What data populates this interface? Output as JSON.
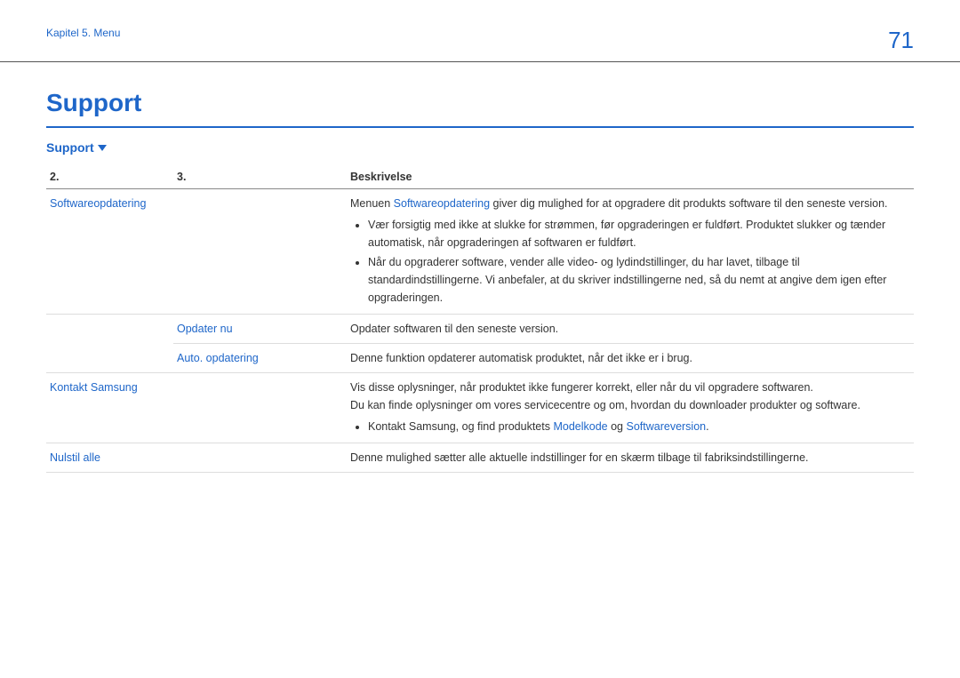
{
  "header": {
    "chapter": "Kapitel 5. Menu",
    "page_number": "71"
  },
  "title": "Support",
  "subtitle": "Support",
  "table": {
    "headers": {
      "col1": "2.",
      "col2": "3.",
      "col3": "Beskrivelse"
    },
    "rows": {
      "r1": {
        "col1": "Softwareopdatering",
        "desc_prefix": "Menuen ",
        "desc_menu": "Softwareopdatering",
        "desc_suffix": " giver dig mulighed for at opgradere dit produkts software til den seneste version.",
        "bullet1": "Vær forsigtig med ikke at slukke for strømmen, før opgraderingen er fuldført. Produktet slukker og tænder automatisk, når opgraderingen af softwaren er fuldført.",
        "bullet2": "Når du opgraderer software, vender alle video- og lydindstillinger, du har lavet, tilbage til standardindstillingerne. Vi anbefaler, at du skriver indstillingerne ned, så du nemt at angive dem igen efter opgraderingen."
      },
      "r2": {
        "col2": "Opdater nu",
        "desc": "Opdater softwaren til den seneste version."
      },
      "r3": {
        "col2": "Auto. opdatering",
        "desc": "Denne funktion opdaterer automatisk produktet, når det ikke er i brug."
      },
      "r4": {
        "col1": "Kontakt Samsung",
        "desc_line1": "Vis disse oplysninger, når produktet ikke fungerer korrekt, eller når du vil opgradere softwaren.",
        "desc_line2": "Du kan finde oplysninger om vores servicecentre og om, hvordan du downloader produkter og software.",
        "bullet_prefix": "Kontakt Samsung, og find produktets ",
        "bullet_menu1": "Modelkode",
        "bullet_mid": " og ",
        "bullet_menu2": "Softwareversion",
        "bullet_suffix": "."
      },
      "r5": {
        "col1": "Nulstil alle",
        "desc": "Denne mulighed sætter alle aktuelle indstillinger for en skærm tilbage til fabriksindstillingerne."
      }
    }
  }
}
